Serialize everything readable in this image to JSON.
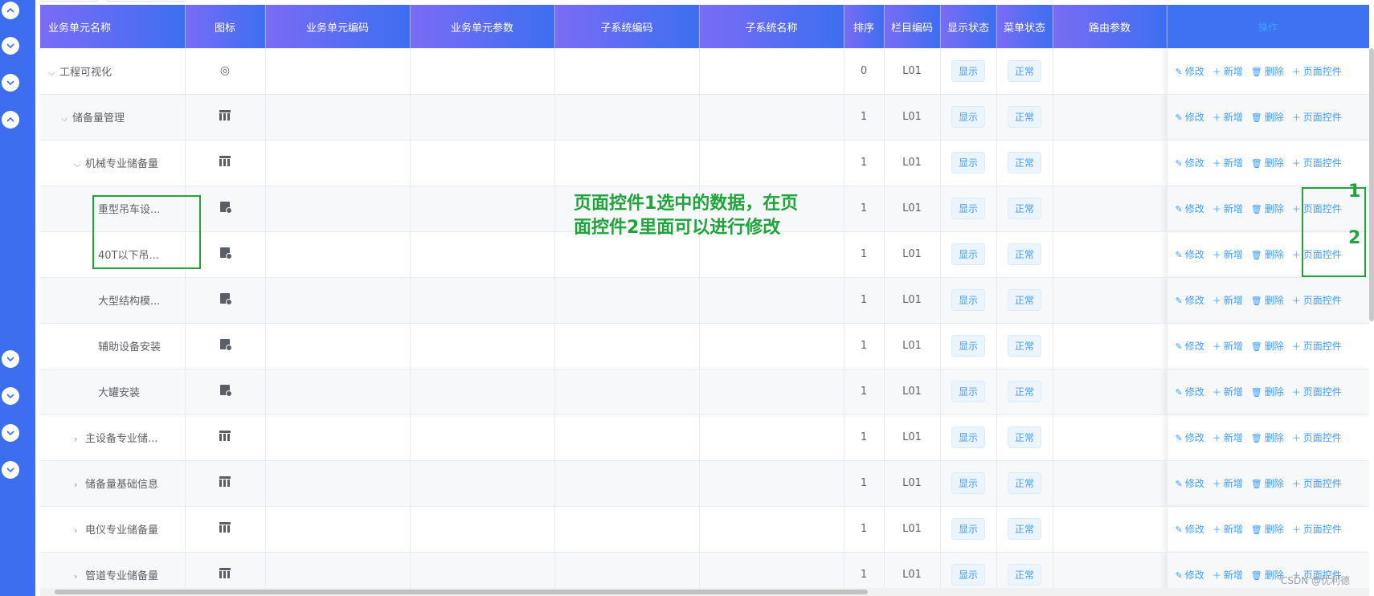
{
  "columns": [
    "业务单元名称",
    "图标",
    "业务单元编码",
    "业务单元参数",
    "子系统编码",
    "子系统名称",
    "排序",
    "栏目编码",
    "显示状态",
    "菜单状态",
    "路由参数",
    "操作"
  ],
  "ops": {
    "edit": "修改",
    "add": "新增",
    "delete": "删除",
    "page_ctrl": "页面控件"
  },
  "rows": [
    {
      "name": "工程可视化",
      "indent": 0,
      "caret": "down",
      "icon": "palette-icon",
      "sort": "0",
      "code": "L01",
      "display": "显示",
      "menu": "正常"
    },
    {
      "name": "储备量管理",
      "indent": 1,
      "caret": "down",
      "icon": "grid-icon",
      "sort": "1",
      "code": "L01",
      "display": "显示",
      "menu": "正常"
    },
    {
      "name": "机械专业储备量",
      "indent": 2,
      "caret": "down",
      "icon": "grid-icon",
      "sort": "1",
      "code": "L01",
      "display": "显示",
      "menu": "正常"
    },
    {
      "name": "重型吊车设...",
      "indent": 3,
      "caret": "",
      "icon": "doc-icon",
      "sort": "1",
      "code": "L01",
      "display": "显示",
      "menu": "正常"
    },
    {
      "name": "40T以下吊...",
      "indent": 3,
      "caret": "",
      "icon": "doc-icon",
      "sort": "1",
      "code": "L01",
      "display": "显示",
      "menu": "正常"
    },
    {
      "name": "大型结构模...",
      "indent": 3,
      "caret": "",
      "icon": "doc-icon",
      "sort": "1",
      "code": "L01",
      "display": "显示",
      "menu": "正常"
    },
    {
      "name": "辅助设备安装",
      "indent": 3,
      "caret": "",
      "icon": "doc-icon",
      "sort": "1",
      "code": "L01",
      "display": "显示",
      "menu": "正常"
    },
    {
      "name": "大罐安装",
      "indent": 3,
      "caret": "",
      "icon": "doc-icon",
      "sort": "1",
      "code": "L01",
      "display": "显示",
      "menu": "正常"
    },
    {
      "name": "主设备专业储...",
      "indent": 2,
      "caret": "right",
      "icon": "grid-icon",
      "sort": "1",
      "code": "L01",
      "display": "显示",
      "menu": "正常"
    },
    {
      "name": "储备量基础信息",
      "indent": 2,
      "caret": "right",
      "icon": "grid-icon",
      "sort": "1",
      "code": "L01",
      "display": "显示",
      "menu": "正常"
    },
    {
      "name": "电仪专业储备量",
      "indent": 2,
      "caret": "right",
      "icon": "grid-icon",
      "sort": "1",
      "code": "L01",
      "display": "显示",
      "menu": "正常"
    },
    {
      "name": "管道专业储备量",
      "indent": 2,
      "caret": "right",
      "icon": "grid-icon",
      "sort": "1",
      "code": "L01",
      "display": "显示",
      "menu": "正常"
    }
  ],
  "annotation": {
    "text": "页面控件1选中的数据，在页面控件2里面可以进行修改",
    "num1": "1",
    "num2": "2",
    "color": "#1fa33a"
  },
  "watermark": "CSDN @优利德"
}
